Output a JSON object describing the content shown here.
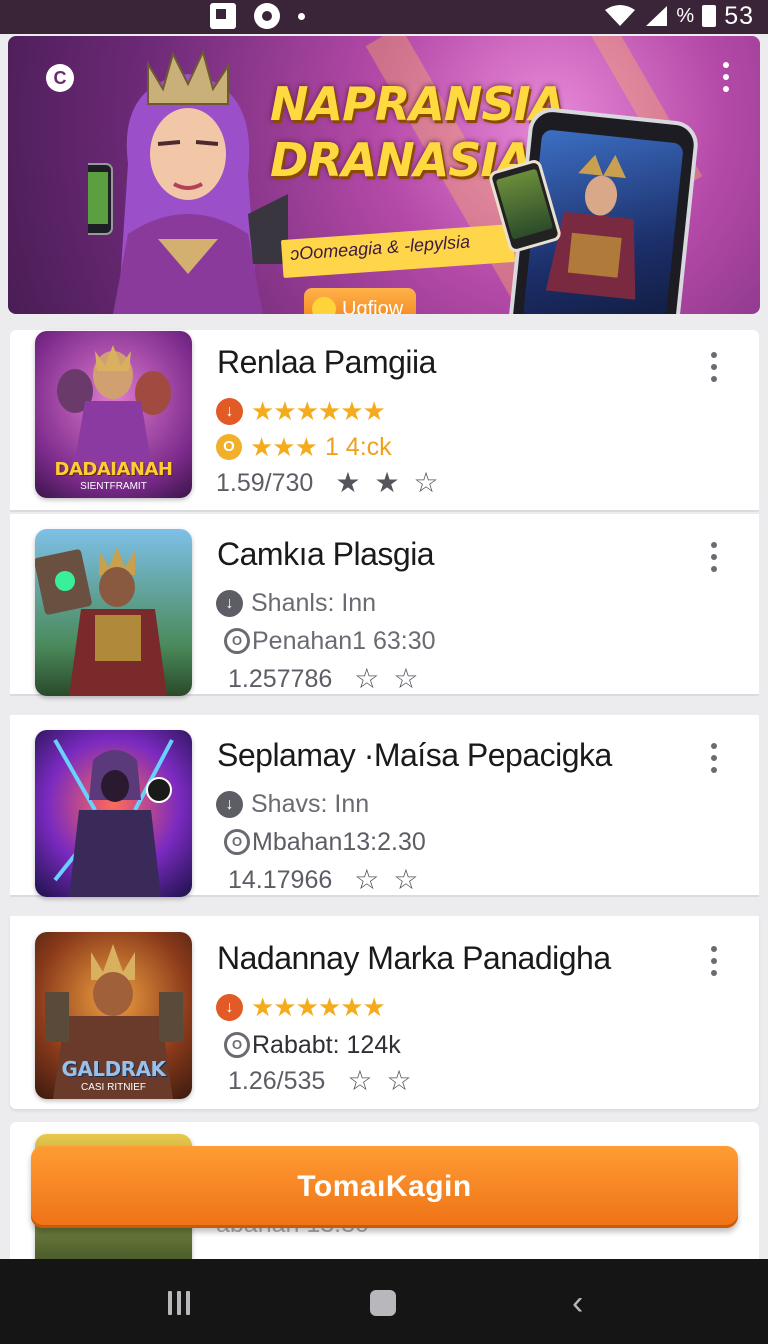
{
  "status_bar": {
    "time": "53",
    "battery_text": "%"
  },
  "banner": {
    "title": "NAPRANSIA DRANASIA",
    "subtitle": "ɔOomeagia & -lepylsia",
    "cta_label": "Ugfiow",
    "colors": {
      "bg": "#b54aa8",
      "title": "#ffd940",
      "cta": "#ef7b14"
    }
  },
  "apps": [
    {
      "title": "Renlaa Pamgiia",
      "thumb_logo": "DADAIANAH",
      "thumb_sub": "SIENTFRAMIT",
      "line1": {
        "icon": "download-icon",
        "stars": "★★★★★★",
        "text": ""
      },
      "line2": {
        "icon": "coin-icon",
        "stars": "★★★",
        "text": "1 4:ck"
      },
      "rating": "1.59/730"
    },
    {
      "title": "Camkıa Plasgia",
      "thumb_logo": "",
      "thumb_sub": "",
      "line1": {
        "icon": "download-icon",
        "stars": "",
        "text": "Shanls: Inn"
      },
      "line2": {
        "icon": "clock-icon",
        "stars": "",
        "text": "Penahan1 63:30"
      },
      "rating": "1.257786"
    },
    {
      "title": "Seplamay ·Maísa Pepacigka",
      "thumb_logo": "",
      "thumb_sub": "",
      "line1": {
        "icon": "download-icon",
        "stars": "",
        "text": "Shavs: Inn"
      },
      "line2": {
        "icon": "clock-icon",
        "stars": "",
        "text": "Mbahan13:2.30"
      },
      "rating": "14.17966"
    },
    {
      "title": "Nadannay Marka Panadigha",
      "thumb_logo": "GALDRAK",
      "thumb_sub": "CASI RITNIEF",
      "line1": {
        "icon": "download-icon",
        "stars": "★★★★★★",
        "text": ""
      },
      "line2": {
        "icon": "clock-icon",
        "stars": "",
        "text": "Rababt: 124k"
      },
      "rating": "1.26/535"
    }
  ],
  "partial_ghost": "abanan 13:30",
  "primary_button": "TomaıKagin",
  "icons": {
    "more": "more-vertical-icon",
    "star_outline": "star-outline-icon",
    "star_filled": "star-filled-icon",
    "nav_recents": "recents-icon",
    "nav_home": "home-icon",
    "nav_back": "back-icon"
  }
}
